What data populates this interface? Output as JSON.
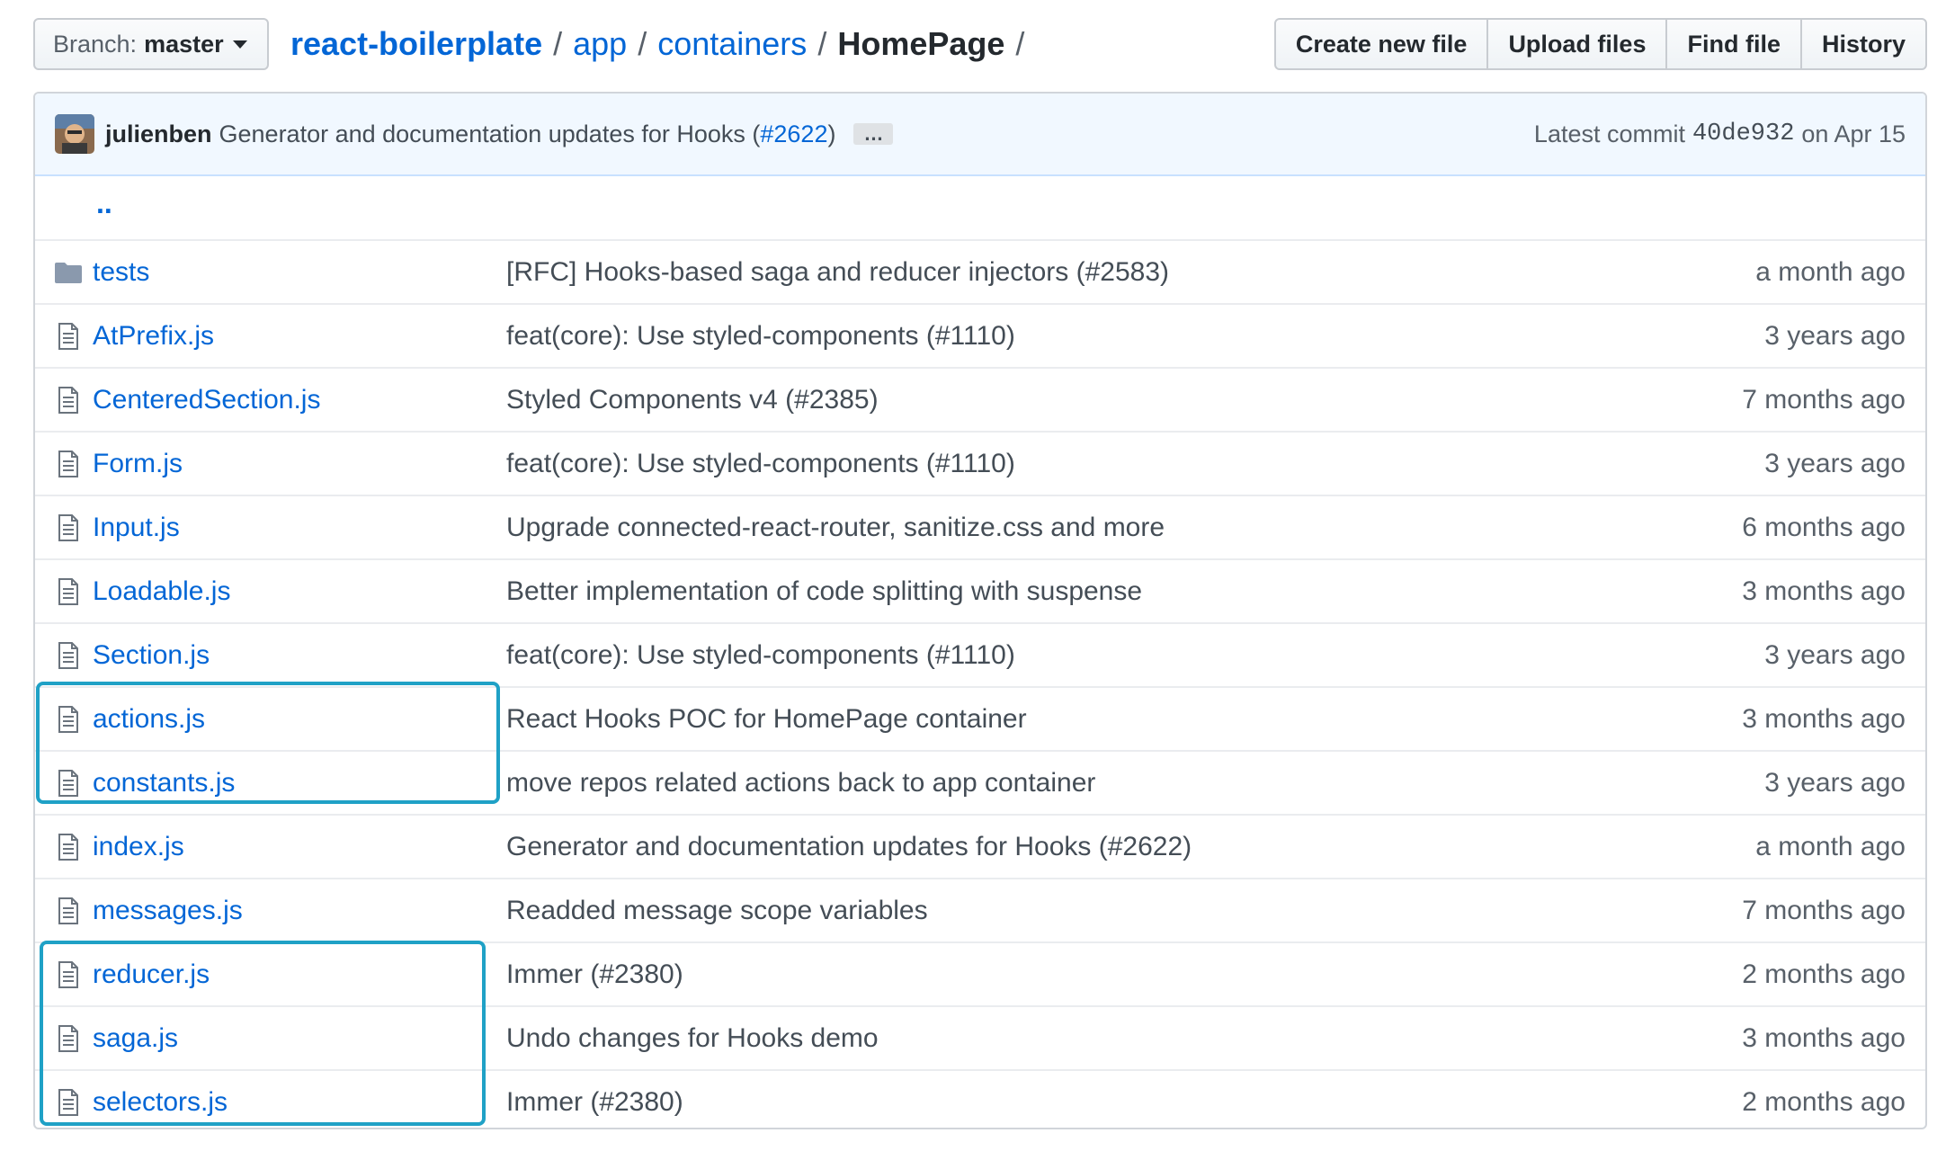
{
  "branch": {
    "label": "Branch:",
    "value": "master"
  },
  "breadcrumb": {
    "root": "react-boilerplate",
    "parts": [
      "app",
      "containers"
    ],
    "current": "HomePage",
    "sep": "/"
  },
  "actions": {
    "create": "Create new file",
    "upload": "Upload files",
    "find": "Find file",
    "history": "History"
  },
  "commit": {
    "author": "julienben",
    "message_prefix": "Generator and documentation updates for Hooks (",
    "pr_link": "#2622",
    "message_suffix": ")",
    "ellipsis": "…",
    "latest_label": "Latest commit",
    "sha": "40de932",
    "date": "on Apr 15"
  },
  "up_link": "..",
  "files": [
    {
      "name": "tests",
      "type": "dir",
      "message": "[RFC] Hooks-based saga and reducer injectors (#2583)",
      "age": "a month ago"
    },
    {
      "name": "AtPrefix.js",
      "type": "file",
      "message": "feat(core): Use styled-components (#1110)",
      "age": "3 years ago"
    },
    {
      "name": "CenteredSection.js",
      "type": "file",
      "message": "Styled Components v4 (#2385)",
      "age": "7 months ago"
    },
    {
      "name": "Form.js",
      "type": "file",
      "message": "feat(core): Use styled-components (#1110)",
      "age": "3 years ago"
    },
    {
      "name": "Input.js",
      "type": "file",
      "message": "Upgrade connected-react-router, sanitize.css and more",
      "age": "6 months ago"
    },
    {
      "name": "Loadable.js",
      "type": "file",
      "message": "Better implementation of code splitting with suspense",
      "age": "3 months ago"
    },
    {
      "name": "Section.js",
      "type": "file",
      "message": "feat(core): Use styled-components (#1110)",
      "age": "3 years ago"
    },
    {
      "name": "actions.js",
      "type": "file",
      "message": "React Hooks POC for HomePage container",
      "age": "3 months ago"
    },
    {
      "name": "constants.js",
      "type": "file",
      "message": "move repos related actions back to app container",
      "age": "3 years ago"
    },
    {
      "name": "index.js",
      "type": "file",
      "message": "Generator and documentation updates for Hooks (#2622)",
      "age": "a month ago"
    },
    {
      "name": "messages.js",
      "type": "file",
      "message": "Readded message scope variables",
      "age": "7 months ago"
    },
    {
      "name": "reducer.js",
      "type": "file",
      "message": "Immer (#2380)",
      "age": "2 months ago"
    },
    {
      "name": "saga.js",
      "type": "file",
      "message": "Undo changes for Hooks demo",
      "age": "3 months ago"
    },
    {
      "name": "selectors.js",
      "type": "file",
      "message": "Immer (#2380)",
      "age": "2 months ago"
    }
  ],
  "colors": {
    "link": "#0366d6",
    "highlight": "#1fa1c6",
    "commit_bg": "#f1f8ff"
  }
}
